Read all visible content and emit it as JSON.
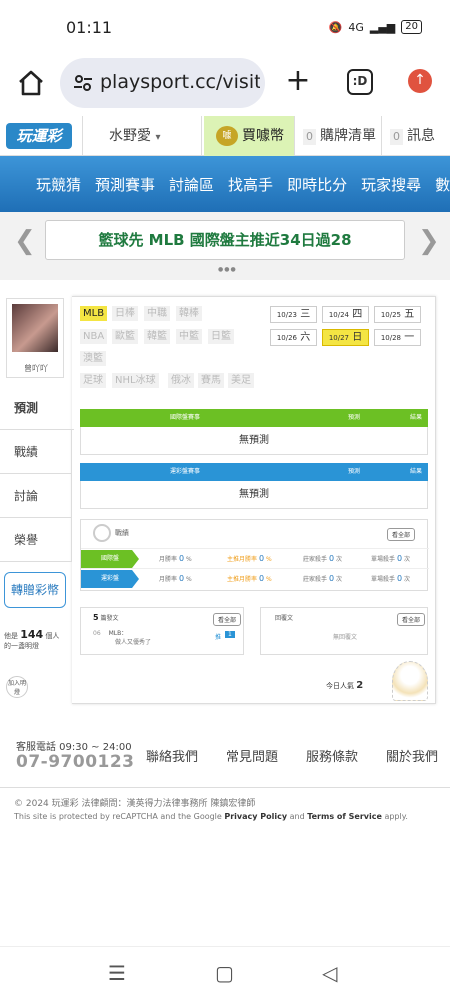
{
  "status_bar": {
    "time": "01:11",
    "signal": "4G",
    "battery": "20"
  },
  "browser": {
    "url": "playsport.cc/visit",
    "tabs_label": ":D"
  },
  "site_header": {
    "logo": "玩運彩",
    "username": "水野愛",
    "coin_label": "買噱幣",
    "coin_icon_text": "噱",
    "cart_count": "0",
    "cart_label": "購牌清單",
    "msg_count": "0",
    "msg_label": "訊息"
  },
  "nav": [
    "玩競猜",
    "預測賽事",
    "討論區",
    "找高手",
    "即時比分",
    "玩家搜尋",
    "數據"
  ],
  "banner": {
    "text": "籃球先 MLB 國際盤主推近34日過28"
  },
  "profile": {
    "name": "曾吖吖"
  },
  "side_tabs": [
    "預測",
    "戰績",
    "討論",
    "榮譽"
  ],
  "upgrade_button": "轉贈彩幣",
  "fans": {
    "prefix": "他是",
    "count": "144",
    "suffix": "個人的一盞明燈"
  },
  "join_button": "加入明燈",
  "leagues": [
    "MLB",
    "日棒",
    "中職",
    "韓棒",
    "NBA",
    "歐籃",
    "韓籃",
    "中籃",
    "日籃",
    "澳籃",
    "足球",
    "NHL冰球",
    "俄冰",
    "賽馬",
    "美足"
  ],
  "dates": [
    {
      "md": "10/23",
      "day": "三"
    },
    {
      "md": "10/24",
      "day": "四"
    },
    {
      "md": "10/25",
      "day": "五"
    },
    {
      "md": "10/26",
      "day": "六"
    },
    {
      "md": "10/27",
      "day": "日"
    },
    {
      "md": "10/28",
      "day": "一"
    }
  ],
  "intl_table": {
    "col1": "國際盤賽事",
    "col2": "預測",
    "col3": "結果",
    "empty": "無預測"
  },
  "tw_table": {
    "col1": "運彩盤賽事",
    "col2": "預測",
    "col3": "結果",
    "empty": "無預測"
  },
  "record": {
    "title": "戰績",
    "see_all": "看全部",
    "rows": [
      {
        "label": "國際盤",
        "monthly_label": "月勝率",
        "monthly": "0",
        "host_label": "主推月勝率",
        "host": "0",
        "bank_label": "莊家殺手",
        "bank": "0",
        "bank_unit": "次",
        "single_label": "單場殺手",
        "single": "0",
        "single_unit": "次"
      },
      {
        "label": "運彩盤",
        "monthly_label": "月勝率",
        "monthly": "0",
        "host_label": "主推月勝率",
        "host": "0",
        "bank_label": "莊家殺手",
        "bank": "0",
        "bank_unit": "次",
        "single_label": "單場殺手",
        "single": "0",
        "single_unit": "次"
      }
    ],
    "percent": "%"
  },
  "posts": {
    "count": "5",
    "title": "篇發文",
    "see_all": "看全部",
    "item_date": "06",
    "item_league": "MLB：",
    "item_text": "做人又優秀了",
    "item_tag": "推",
    "item_num": "1"
  },
  "replies": {
    "title": "回覆文",
    "see_all": "看全部",
    "empty": "無回覆文"
  },
  "visitors": {
    "label": "今日人氣",
    "count": "2"
  },
  "footer": {
    "hotline_label": "客服電話 09:30 ~ 24:00",
    "hotline": "07-9700123",
    "links": [
      "聯絡我們",
      "常見問題",
      "服務條款",
      "關於我們"
    ],
    "copyright": "© 2024 玩運彩 法律顧問：漢英得力法律事務所 陳鎮宏律師",
    "captcha_pre": "This site is protected by reCAPTCHA and the Google ",
    "privacy": "Privacy Policy",
    "and": " and ",
    "terms": "Terms of Service",
    "apply": " apply."
  },
  "colors": {
    "nav_blue": "#2a7fc4",
    "green": "#6cc024",
    "blue_bar": "#2a94d6",
    "accent_yellow": "#f4e543"
  }
}
